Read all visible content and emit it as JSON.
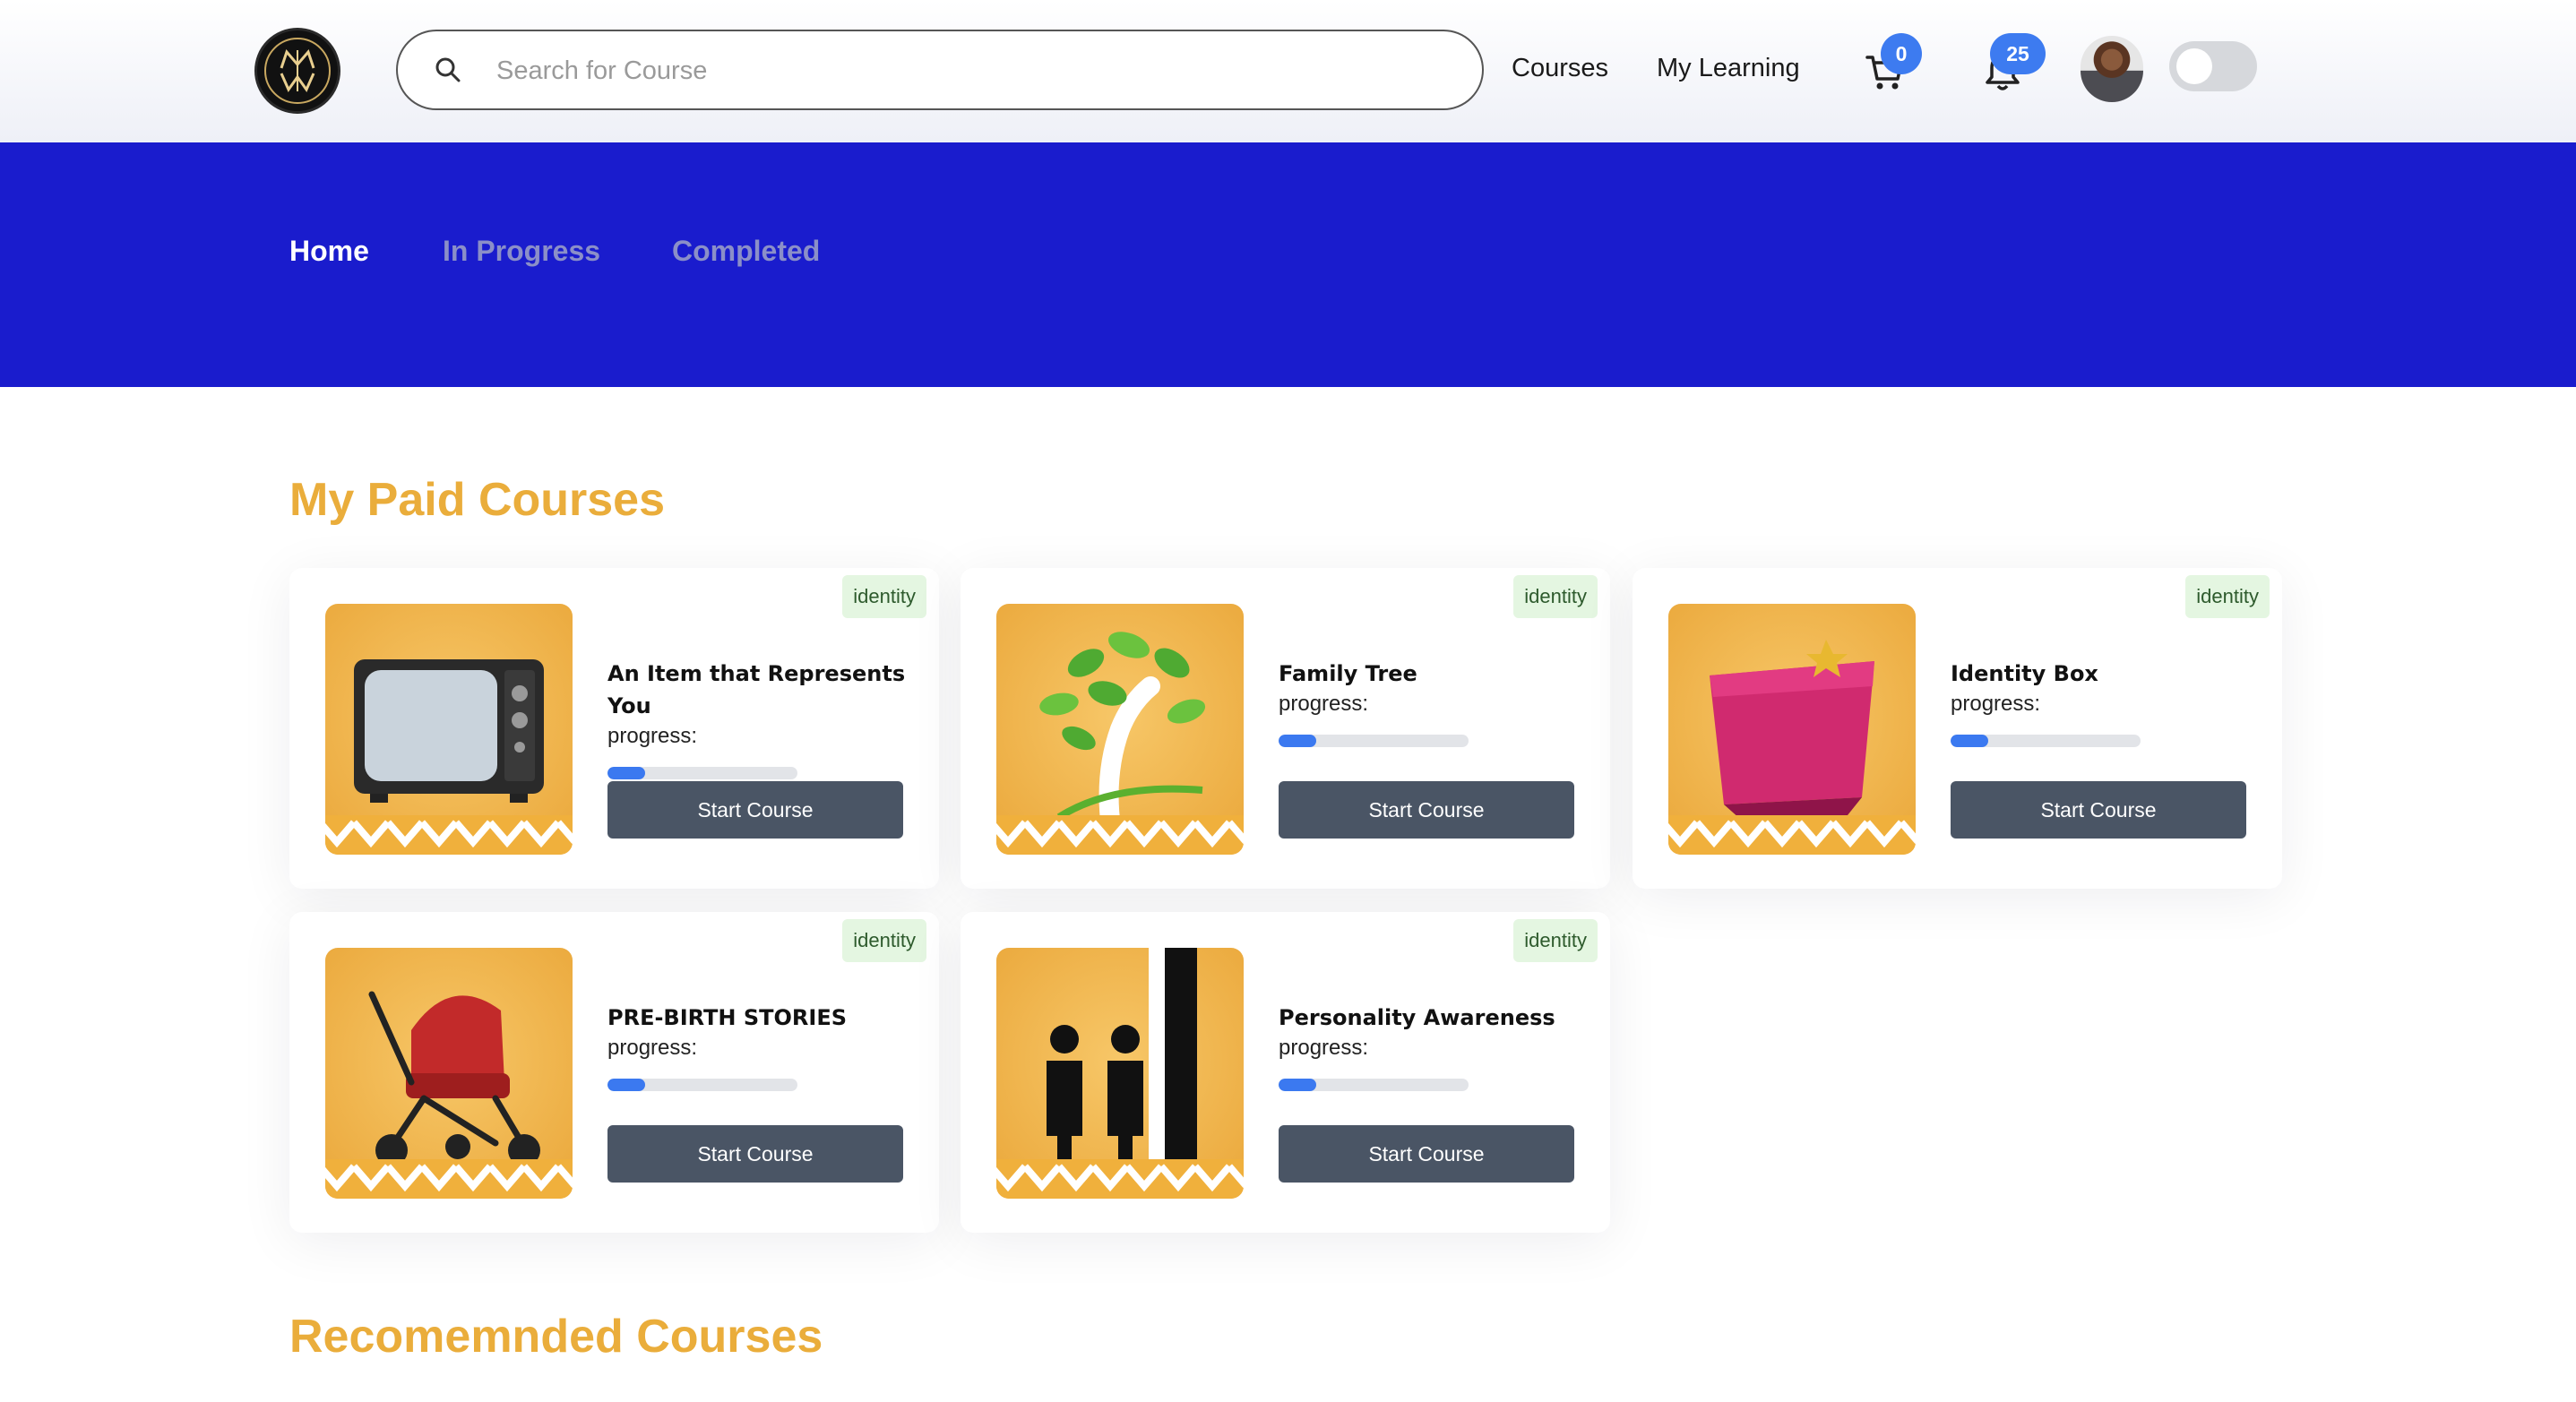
{
  "header": {
    "logo_alt": "MW",
    "search_placeholder": "Search for Course",
    "nav": {
      "courses": "Courses",
      "my_learning": "My Learning"
    },
    "cart_count": "0",
    "notification_count": "25",
    "dark_mode_enabled": false
  },
  "tabs": [
    "Home",
    "In Progress",
    "Completed"
  ],
  "active_tab": "Home",
  "sections": {
    "paid_title": "My Paid Courses",
    "recommended_title": "Recomemnded Courses"
  },
  "colors": {
    "brand_blue": "#1a1ccd",
    "heading_gold": "#eaad3b",
    "progress_blue": "#3b79f0",
    "button_slate": "#4a5565",
    "tag_green_bg": "#e4f6e1"
  },
  "courses": [
    {
      "title": "An Item that Represents You",
      "tag": "identity",
      "progress_label": "progress:",
      "progress": 0.2,
      "button": "Start Course",
      "image": "television"
    },
    {
      "title": "Family Tree",
      "tag": "identity",
      "progress_label": "progress:",
      "progress": 0.2,
      "button": "Start Course",
      "image": "tree"
    },
    {
      "title": "Identity Box",
      "tag": "identity",
      "progress_label": "progress:",
      "progress": 0.2,
      "button": "Start Course",
      "image": "gift-box"
    },
    {
      "title": "PRE-BIRTH STORIES",
      "tag": "identity",
      "progress_label": "progress:",
      "progress": 0.2,
      "button": "Start Course",
      "image": "stroller"
    },
    {
      "title": "Personality Awareness",
      "tag": "identity",
      "progress_label": "progress:",
      "progress": 0.2,
      "button": "Start Course",
      "image": "mirror"
    }
  ]
}
